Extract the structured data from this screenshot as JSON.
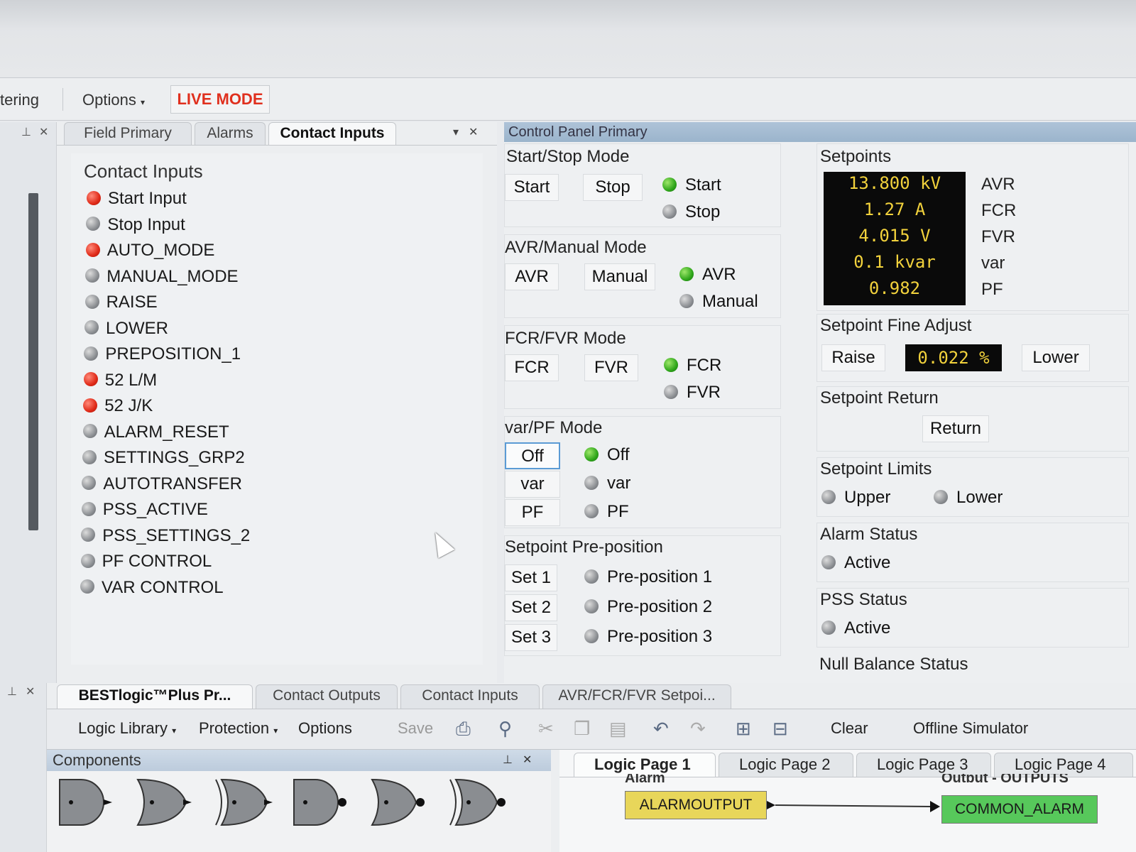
{
  "menubar": {
    "partial_item": "tering",
    "options": "Options",
    "live_mode": "LIVE MODE"
  },
  "left_panel": {
    "tabs": [
      "Field Primary",
      "Alarms",
      "Contact Inputs"
    ],
    "title": "Contact Inputs",
    "items": [
      {
        "label": "Start Input",
        "state": "red"
      },
      {
        "label": "Stop Input",
        "state": "gray"
      },
      {
        "label": "AUTO_MODE",
        "state": "red"
      },
      {
        "label": "MANUAL_MODE",
        "state": "gray"
      },
      {
        "label": "RAISE",
        "state": "gray"
      },
      {
        "label": "LOWER",
        "state": "gray"
      },
      {
        "label": "PREPOSITION_1",
        "state": "gray"
      },
      {
        "label": "52 L/M",
        "state": "red"
      },
      {
        "label": "52 J/K",
        "state": "red"
      },
      {
        "label": "ALARM_RESET",
        "state": "gray"
      },
      {
        "label": "SETTINGS_GRP2",
        "state": "gray"
      },
      {
        "label": "AUTOTRANSFER",
        "state": "gray"
      },
      {
        "label": "PSS_ACTIVE",
        "state": "gray"
      },
      {
        "label": "PSS_SETTINGS_2",
        "state": "gray"
      },
      {
        "label": "PF CONTROL",
        "state": "gray"
      },
      {
        "label": "VAR CONTROL",
        "state": "gray"
      }
    ]
  },
  "control_panel": {
    "title": "Control Panel Primary",
    "start_stop": {
      "title": "Start/Stop Mode",
      "btn_start": "Start",
      "btn_stop": "Stop",
      "ind_start": "Start",
      "ind_stop": "Stop"
    },
    "avr_manual": {
      "title": "AVR/Manual Mode",
      "btn_avr": "AVR",
      "btn_manual": "Manual",
      "ind_avr": "AVR",
      "ind_manual": "Manual"
    },
    "fcr_fvr": {
      "title": "FCR/FVR Mode",
      "btn_fcr": "FCR",
      "btn_fvr": "FVR",
      "ind_fcr": "FCR",
      "ind_fvr": "FVR"
    },
    "var_pf": {
      "title": "var/PF Mode",
      "btn_off": "Off",
      "btn_var": "var",
      "btn_pf": "PF",
      "ind_off": "Off",
      "ind_var": "var",
      "ind_pf": "PF"
    },
    "preposition": {
      "title": "Setpoint Pre-position",
      "btn_set1": "Set 1",
      "btn_set2": "Set 2",
      "btn_set3": "Set 3",
      "ind_1": "Pre-position 1",
      "ind_2": "Pre-position 2",
      "ind_3": "Pre-position 3"
    },
    "setpoints": {
      "title": "Setpoints",
      "rows": [
        {
          "value": "13.800 kV",
          "label": "AVR"
        },
        {
          "value": "1.27 A",
          "label": "FCR"
        },
        {
          "value": "4.015 V",
          "label": "FVR"
        },
        {
          "value": "0.1 kvar",
          "label": "var"
        },
        {
          "value": "0.982",
          "label": "PF"
        }
      ]
    },
    "fine_adjust": {
      "title": "Setpoint Fine Adjust",
      "raise": "Raise",
      "value": "0.022 %",
      "lower": "Lower"
    },
    "setpoint_return": {
      "title": "Setpoint Return",
      "button": "Return"
    },
    "setpoint_limits": {
      "title": "Setpoint Limits",
      "upper": "Upper",
      "lower": "Lower"
    },
    "alarm_status": {
      "title": "Alarm Status",
      "active": "Active"
    },
    "pss_status": {
      "title": "PSS Status",
      "active": "Active"
    },
    "null_balance": {
      "title": "Null Balance Status"
    }
  },
  "bottom": {
    "tabs": [
      "BESTlogic™Plus Pr...",
      "Contact Outputs",
      "Contact Inputs",
      "AVR/FCR/FVR Setpoi..."
    ],
    "toolbar": {
      "logic_library": "Logic Library",
      "protection": "Protection",
      "options": "Options",
      "save": "Save",
      "clear": "Clear",
      "offline_simulator": "Offline Simulator"
    },
    "components_title": "Components",
    "logic_tabs": [
      "Logic Page 1",
      "Logic Page 2",
      "Logic Page 3",
      "Logic Page 4"
    ],
    "logic": {
      "alarm_label": "Alarm",
      "alarm_output": "ALARMOUTPUT",
      "output_label": "Output - OUTPUTS",
      "common_alarm": "COMMON_ALARM"
    }
  },
  "colors": {
    "live_mode": "#e0301e",
    "readout_text": "#f2d23c",
    "alarm_block": "#e8d65a",
    "output_block": "#57c85b"
  }
}
